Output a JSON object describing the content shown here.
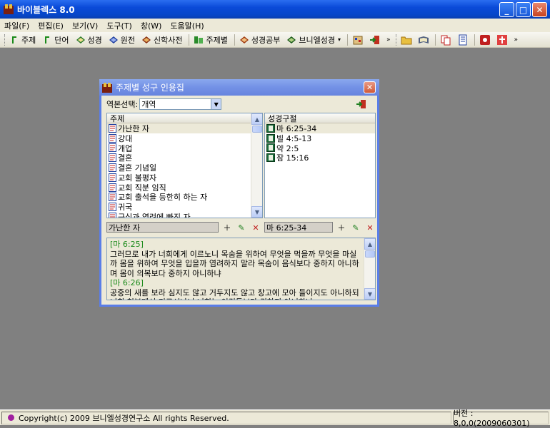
{
  "app": {
    "title": "바이블렉스 8.0",
    "window_buttons": {
      "minimize": "_",
      "maximize": "□",
      "close": "✕"
    }
  },
  "menu": [
    "파일(F)",
    "편집(E)",
    "보기(V)",
    "도구(T)",
    "창(W)",
    "도움말(H)"
  ],
  "toolbar": {
    "items": [
      {
        "label": "주제",
        "icon": "bracket-icon"
      },
      {
        "label": "단어",
        "icon": "bracket-icon"
      },
      {
        "label": "성경",
        "icon": "book-icon"
      },
      {
        "label": "원전",
        "icon": "book-icon"
      },
      {
        "label": "신학사전",
        "icon": "book-icon"
      },
      {
        "label": "주제별",
        "icon": "tree-icon"
      },
      {
        "label": "성경공부",
        "icon": "book-icon"
      },
      {
        "label": "브니엘성경",
        "icon": "book-icon"
      }
    ],
    "dropdown_arrow": "▾",
    "overflow": "»"
  },
  "child": {
    "title": "주제별 성구 인용집",
    "close": "✕",
    "version_label": "역본선택:",
    "version_value": "개역",
    "topics_header": "주제",
    "topics": [
      "가난한 자",
      "강대",
      "개업",
      "결혼",
      "결혼 기념일",
      "교회 불평자",
      "교회 직분 임직",
      "교회 출석을 등한히 하는 자",
      "귀국",
      "근심과 염려에 빠진 자"
    ],
    "verses_header": "성경구절",
    "verses": [
      "마 6:25-34",
      "빌 4:5-13",
      "약 2:5",
      "잠 15:16"
    ],
    "topic_field": "가난한 자",
    "verse_field": "마 6:25-34",
    "text": [
      {
        "type": "ref",
        "text": "[마 6:25]"
      },
      {
        "type": "body",
        "text": "그러므로 내가 너희에게 이르노니 목숨을 위하여 무엇을 먹을까 무엇을 마실까 몸을 위하여 무엇을 입을까 염려하지 말라 목숨이 음식보다 중하지 아니하며 몸이 의복보다 중하지 아니하냐"
      },
      {
        "type": "ref",
        "text": "[마 6:26]"
      },
      {
        "type": "body",
        "text": "공중의 새를 보라 심지도 않고 거두지도 않고 창고에 모아 들이지도 아니하되 너희 천부께서 기르시나니 너희는 이것들보다 귀하지 아니하냐"
      }
    ]
  },
  "status": {
    "copyright": "Copyright(c) 2009 브니엘성경연구소 All rights Reserved.",
    "version": "버전 : 8,0,0(2009060301)"
  },
  "colors": {
    "title_blue": "#0a4ad8",
    "child_title": "#7391e6",
    "face": "#ece9d8",
    "mdi_bg": "#808080",
    "ref_green": "#1a8a1a"
  }
}
